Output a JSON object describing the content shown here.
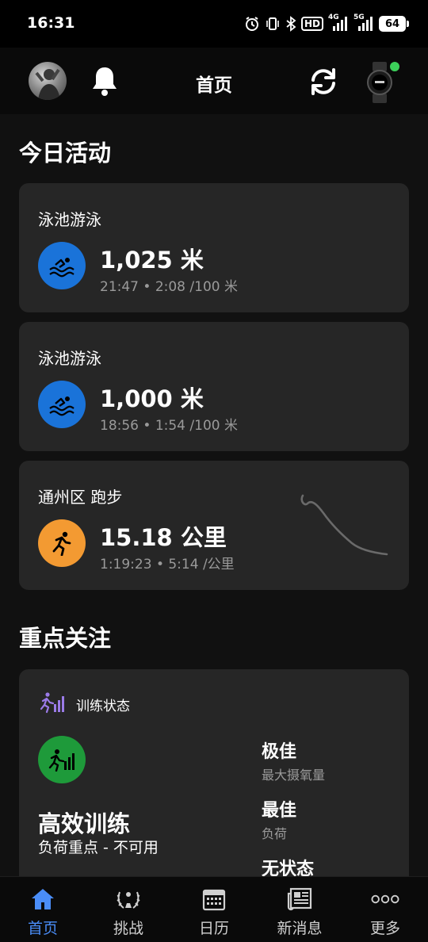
{
  "status_bar": {
    "time": "16:31",
    "hd_label": "HD",
    "net_label": "4G",
    "net2_label": "5G",
    "battery": "64"
  },
  "app_bar": {
    "title": "首页",
    "watch_connected_color": "#3ccf5a"
  },
  "today": {
    "section_title": "今日活动",
    "activities": [
      {
        "title": "泳池游泳",
        "value": "1,025 米",
        "detail": "21:47 • 2:08 /100 米",
        "icon": "swimming-icon",
        "color": "#1a73d9"
      },
      {
        "title": "泳池游泳",
        "value": "1,000 米",
        "detail": "18:56 • 1:54 /100 米",
        "icon": "swimming-icon",
        "color": "#1a73d9"
      },
      {
        "title": "通州区 跑步",
        "value": "15.18 公里",
        "detail": "1:19:23 • 5:14 /公里",
        "icon": "running-icon",
        "color": "#f39a32"
      }
    ]
  },
  "focus": {
    "section_title": "重点关注",
    "card": {
      "header": "训练状态",
      "status": "高效训练",
      "status_sub": "负荷重点 - 不可用",
      "metrics": [
        {
          "value": "极佳",
          "label": "最大摄氧量"
        },
        {
          "value": "最佳",
          "label": "负荷"
        },
        {
          "value": "无状态",
          "label": ""
        }
      ]
    }
  },
  "bottom_nav": {
    "items": [
      {
        "label": "首页",
        "icon": "home-icon",
        "active": true
      },
      {
        "label": "挑战",
        "icon": "laurel-icon",
        "active": false
      },
      {
        "label": "日历",
        "icon": "calendar-icon",
        "active": false
      },
      {
        "label": "新消息",
        "icon": "news-icon",
        "active": false
      },
      {
        "label": "更多",
        "icon": "more-icon",
        "active": false
      }
    ],
    "active_color": "#4a8df8"
  }
}
